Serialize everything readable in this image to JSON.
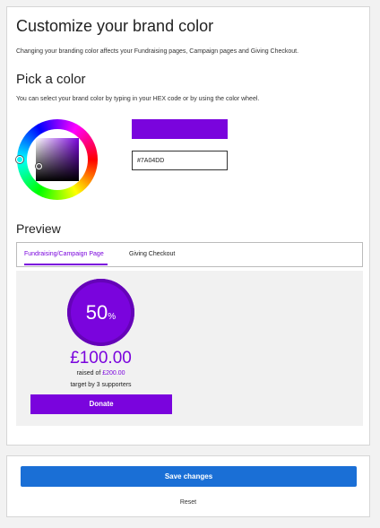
{
  "page": {
    "title": "Customize your brand color",
    "description": "Changing your branding color affects your Fundraising pages, Campaign pages and Giving Checkout."
  },
  "picker": {
    "heading": "Pick a color",
    "description": "You can select your brand color by typing in your HEX code or by using the color wheel.",
    "hex_value": "#7A04DD",
    "swatch_color": "#7A04DD"
  },
  "preview": {
    "heading": "Preview",
    "tabs": [
      {
        "label": "Fundraising/Campaign Page",
        "active": true
      },
      {
        "label": "Giving Checkout",
        "active": false
      }
    ],
    "progress_value": "50",
    "progress_unit": "%",
    "raised_amount": "£100.00",
    "raised_prefix": "raised of",
    "target_amount": "£200.00",
    "target_text": "target by 3 supporters",
    "donate_label": "Donate"
  },
  "footer": {
    "save_label": "Save changes",
    "reset_label": "Reset"
  },
  "colors": {
    "brand": "#7A04DD",
    "save_button": "#1A6FD6"
  }
}
